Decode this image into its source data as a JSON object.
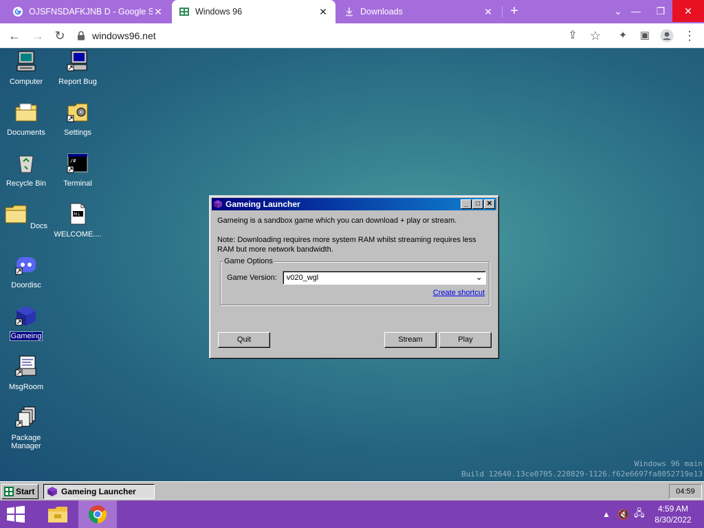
{
  "browser": {
    "tabs": [
      {
        "title": "OJSFNSDAFKJNB D - Google Sea",
        "icon": "google-icon",
        "active": false
      },
      {
        "title": "Windows 96",
        "icon": "windows96-icon",
        "active": true
      },
      {
        "title": "Downloads",
        "icon": "download-icon",
        "active": false
      }
    ],
    "url": "windows96.net"
  },
  "desktop": {
    "icons": [
      {
        "label": "Computer",
        "icon": "computer-icon"
      },
      {
        "label": "Report Bug",
        "icon": "report-bug-icon"
      },
      {
        "label": "Documents",
        "icon": "documents-folder-icon"
      },
      {
        "label": "Settings",
        "icon": "settings-folder-icon"
      },
      {
        "label": "Recycle Bin",
        "icon": "recycle-bin-icon"
      },
      {
        "label": "Terminal",
        "icon": "terminal-icon"
      },
      {
        "label": "Docs",
        "icon": "folder-icon"
      },
      {
        "label": "WELCOME....",
        "icon": "markdown-file-icon"
      },
      {
        "label": "Doordisc",
        "icon": "doordisc-icon"
      },
      {
        "label": "Gameing",
        "icon": "gameing-cube-icon"
      },
      {
        "label": "MsgRoom",
        "icon": "msgroom-icon"
      },
      {
        "label": "Package Manager",
        "icon": "package-manager-icon"
      }
    ],
    "watermark_line1": "Windows 96 main",
    "watermark_line2": "Build 12640.13ce0705.220829-1126.f62e6697fa8052719e13"
  },
  "launcher": {
    "title": "Gameing Launcher",
    "description": "Gameing is a sandbox game which you can download + play or stream.",
    "note": "Note: Downloading requires more system RAM whilst streaming requires less RAM but more network bandwidth.",
    "group_label": "Game Options",
    "version_label": "Game Version:",
    "version_value": "v020_wgl",
    "shortcut_link": "Create shortcut",
    "quit_label": "Quit",
    "stream_label": "Stream",
    "play_label": "Play"
  },
  "taskbar96": {
    "start_label": "Start",
    "task_label": "Gameing Launcher",
    "time": "04:59"
  },
  "windows_taskbar": {
    "time": "4:59 AM",
    "date": "8/30/2022"
  }
}
